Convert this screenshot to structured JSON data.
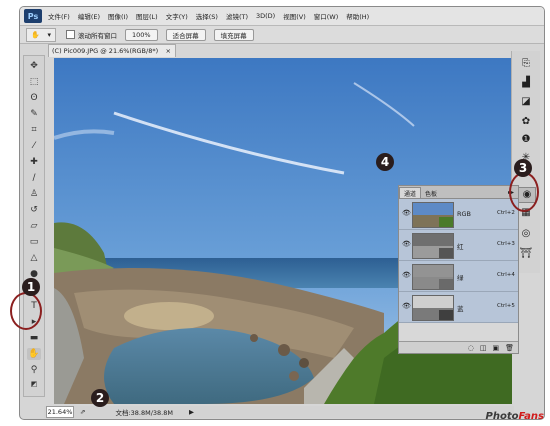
{
  "app": {
    "logo": "Ps",
    "watermark_prefix": "Photo",
    "watermark_accent": "Fans",
    "accent_color": "#8b1f1f"
  },
  "menu": [
    "文件(F)",
    "编辑(E)",
    "图像(I)",
    "图层(L)",
    "文字(Y)",
    "选择(S)",
    "滤镜(T)",
    "3D(D)",
    "视图(V)",
    "窗口(W)",
    "帮助(H)"
  ],
  "options": {
    "tool_icon": "hand-icon",
    "scroll_all_label": "滚动所有窗口",
    "zoom_label": "100%",
    "fit_screen_label": "适合屏幕",
    "fill_screen_label": "填充屏幕"
  },
  "document": {
    "tab_title": "(C) Pic009.JPG @ 21.6%(RGB/8*)",
    "tab_close": "×"
  },
  "status": {
    "zoom": "21.64%",
    "doc_info": "文档:38.8M/38.8M",
    "arrow": "▶"
  },
  "channels_panel": {
    "tab_channels": "通道",
    "tab_paths": "色板",
    "menu_icon": "▸▸",
    "rows": [
      {
        "name": "RGB",
        "shortcut": "Ctrl+2"
      },
      {
        "name": "红",
        "shortcut": "Ctrl+3"
      },
      {
        "name": "绿",
        "shortcut": "Ctrl+4"
      },
      {
        "name": "蓝",
        "shortcut": "Ctrl+5"
      }
    ]
  },
  "badges": {
    "one": "1",
    "two": "2",
    "three": "3",
    "four": "4"
  },
  "tools": [
    "move-icon",
    "marquee-icon",
    "lasso-icon",
    "quick-select-icon",
    "crop-icon",
    "eyedropper-icon",
    "healing-icon",
    "brush-icon",
    "stamp-icon",
    "history-brush-icon",
    "eraser-icon",
    "gradient-icon",
    "blur-icon",
    "dodge-icon",
    "pen-icon",
    "type-icon",
    "path-select-icon",
    "shape-icon",
    "hand-icon",
    "zoom-icon"
  ]
}
